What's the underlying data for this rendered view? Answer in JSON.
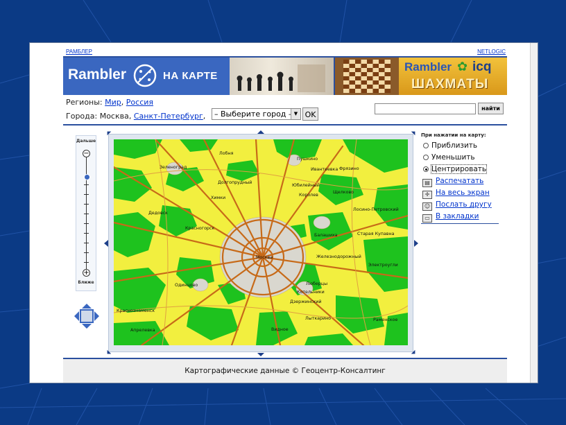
{
  "header": {
    "left_link": "РАМБЛЕР",
    "right_link": "NETLOGIC",
    "logo_text": "Rambler",
    "logo_subtitle": "НА КАРТЕ",
    "ad_rambler": "Rambler",
    "ad_icq": "icq",
    "ad_chess": "ШАХМАТЫ"
  },
  "regions": {
    "label": "Регионы:",
    "world": "Мир",
    "russia": "Россия"
  },
  "cities": {
    "label": "Города:",
    "moscow": "Москва,",
    "spb": "Санкт-Петербург",
    "select_value": "– Выберите город –",
    "ok_label": "OK"
  },
  "search": {
    "value": "",
    "button_label": "найти"
  },
  "zoom": {
    "top_label": "Дальше",
    "bottom_label": "Ближе",
    "level": 0.15
  },
  "map": {
    "places": [
      "Лобня",
      "Пушкино",
      "Ивантеевка",
      "Фрязино",
      "Зеленоград",
      "Долгопрудный",
      "Юбилейный",
      "Королев",
      "Щелково",
      "Химки",
      "Лосино-Петровский",
      "Дедовск",
      "Красногорск",
      "Старая Купавна",
      "Балашиха",
      "Москва",
      "Железнодорожный",
      "Электроугли",
      "Одинцово",
      "Люберцы",
      "Котельники",
      "Дзержинский",
      "Краснознаменск",
      "Апрелевка",
      "Лыткарино",
      "Видное",
      "Раменское"
    ]
  },
  "panel": {
    "title": "При нажатии на карту:",
    "options": [
      {
        "label": "Приблизить",
        "selected": false
      },
      {
        "label": "Уменьшить",
        "selected": false
      },
      {
        "label": "Центрировать",
        "selected": true
      }
    ],
    "actions": [
      {
        "icon": "printer-icon",
        "label": "Распечатать"
      },
      {
        "icon": "fullscreen-icon",
        "label": "На весь экран"
      },
      {
        "icon": "send-friend-icon",
        "label": "Послать другу"
      },
      {
        "icon": "bookmark-icon",
        "label": "В закладки"
      }
    ]
  },
  "footer": {
    "text": "Картографические данные © Геоцентр-Консалтинг"
  },
  "colors": {
    "slide_background": "#0b3a85",
    "brand_blue": "#2a4f9e",
    "map_forest": "#1ec21e",
    "map_open": "#f2ef3f",
    "map_roads": "#c76a18"
  }
}
